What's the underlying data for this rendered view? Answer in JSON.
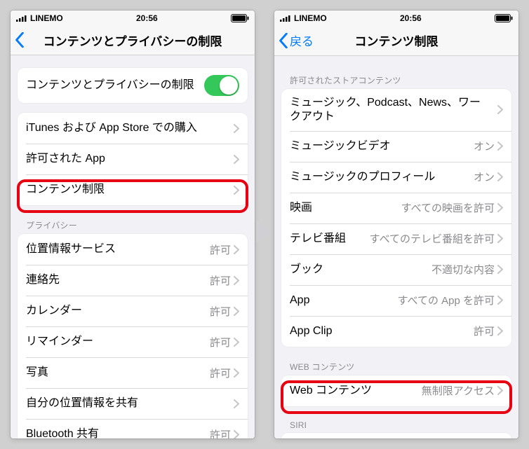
{
  "status": {
    "carrier": "LINEMO",
    "time": "20:56"
  },
  "left": {
    "nav_title": "コンテンツとプライバシーの制限",
    "toggle_label": "コンテンツとプライバシーの制限",
    "group_store": {
      "itunes": "iTunes および App Store での購入",
      "allowed_apps": "許可された App",
      "content_restrict": "コンテンツ制限"
    },
    "privacy_header": "プライバシー",
    "privacy": {
      "location": {
        "label": "位置情報サービス",
        "value": "許可"
      },
      "contacts": {
        "label": "連絡先",
        "value": "許可"
      },
      "calendar": {
        "label": "カレンダー",
        "value": "許可"
      },
      "reminders": {
        "label": "リマインダー",
        "value": "許可"
      },
      "photos": {
        "label": "写真",
        "value": "許可"
      },
      "share_loc": {
        "label": "自分の位置情報を共有",
        "value": ""
      },
      "bluetooth": {
        "label": "Bluetooth 共有",
        "value": "許可"
      }
    }
  },
  "right": {
    "back_label": "戻る",
    "nav_title": "コンテンツ制限",
    "store_header": "許可されたストアコンテンツ",
    "store": {
      "music_podcast": {
        "label": "ミュージック、Podcast、News、ワークアウト",
        "value": ""
      },
      "music_video": {
        "label": "ミュージックビデオ",
        "value": "オン"
      },
      "music_profile": {
        "label": "ミュージックのプロフィール",
        "value": "オン"
      },
      "movies": {
        "label": "映画",
        "value": "すべての映画を許可"
      },
      "tv": {
        "label": "テレビ番組",
        "value": "すべてのテレビ番組を許可"
      },
      "books": {
        "label": "ブック",
        "value": "不適切な内容"
      },
      "app": {
        "label": "App",
        "value": "すべての App を許可"
      },
      "app_clip": {
        "label": "App Clip",
        "value": "許可"
      }
    },
    "web_header": "WEB コンテンツ",
    "web": {
      "label": "Web コンテンツ",
      "value": "無制限アクセス"
    },
    "siri_header": "SIRI"
  }
}
